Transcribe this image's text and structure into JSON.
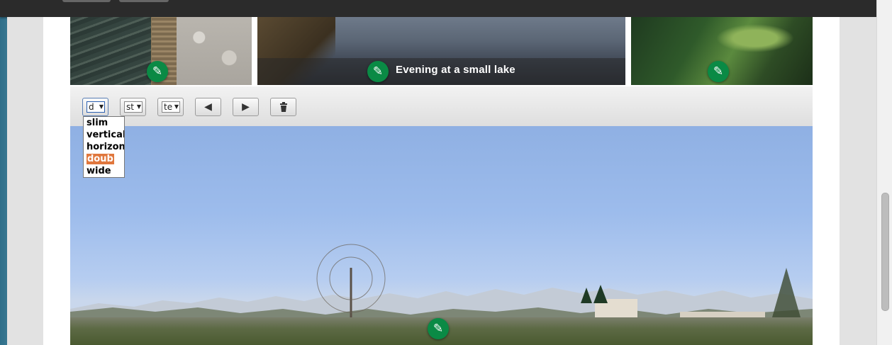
{
  "gallery": {
    "photos": [
      {
        "caption": ""
      },
      {
        "caption": "Evening at a small lake"
      },
      {
        "caption": ""
      }
    ]
  },
  "toolbar": {
    "size_select": {
      "value": "d"
    },
    "style_select": {
      "value": "st"
    },
    "text_select": {
      "value": "te"
    }
  },
  "size_dropdown": {
    "options": [
      "slim",
      "vertical",
      "horizon",
      "doub",
      "wide"
    ],
    "highlighted": "doub"
  },
  "icons": {
    "edit": "pencil-icon",
    "move_left": "arrow-left-icon",
    "move_right": "arrow-right-icon",
    "delete": "trash-icon"
  },
  "colors": {
    "edit_badge": "#0a8a45",
    "highlight": "#e0773d"
  }
}
